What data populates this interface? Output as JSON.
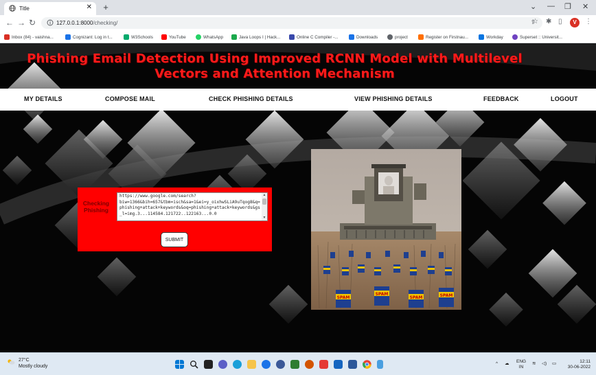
{
  "browser": {
    "tab_title": "Title",
    "new_tab": "+",
    "url_host": "127.0.0.1:8000",
    "url_path": "/checking/",
    "profile_initial": "V",
    "window_controls": [
      "⌄",
      "—",
      "❐",
      "✕"
    ],
    "bookmarks": [
      {
        "label": "Inbox (84) - vaishna...",
        "color": "#d93025"
      },
      {
        "label": "Cognizant: Log in t...",
        "color": "#1a73e8"
      },
      {
        "label": "W3Schools",
        "color": "#04aa6d"
      },
      {
        "label": "YouTube",
        "color": "#ff0000"
      },
      {
        "label": "WhatsApp",
        "color": "#25d366"
      },
      {
        "label": "Java Loops I | Hack...",
        "color": "#1ba94c"
      },
      {
        "label": "Online C Compiler -...",
        "color": "#3949ab"
      },
      {
        "label": "Downloads",
        "color": "#1a73e8"
      },
      {
        "label": "project",
        "color": "#5f6368"
      },
      {
        "label": "Register on Firstnau...",
        "color": "#ff6f00"
      },
      {
        "label": "Workday",
        "color": "#0875e1"
      },
      {
        "label": "Superset :: Universit...",
        "color": "#6f42c1"
      }
    ]
  },
  "site": {
    "title": "Phishing Email Detection Using Improved RCNN Model with Multilevel Vectors and Attention Mechanism",
    "nav": [
      "MY DETAILS",
      "COMPOSE MAIL",
      "CHECK PHISHING DETAILS",
      "VIEW PHISHING DETAILS",
      "FEEDBACK",
      "LOGOUT"
    ],
    "form": {
      "label": "Checking Phishing",
      "url_value": "https://www.google.com/search?biw=1366&bih=657&tbm=isch&sa=1&ei=y_oixhwSLiA9uTqog8&q=phishing+attack+keywords&oq=phishing+attack+keywords&gs_l=img.3...114584.121722..122163...0.0",
      "submit_label": "SUBMIT"
    },
    "image_caption": "SPAM"
  },
  "taskbar": {
    "temperature": "27°C",
    "weather": "Mostly cloudy",
    "lang_top": "ENG",
    "lang_bottom": "IN",
    "time": "12:11",
    "date": "30-06-2022"
  },
  "colors": {
    "title_red": "#ff1a1a",
    "form_red": "#ff0000",
    "page_bg": "#050505"
  }
}
